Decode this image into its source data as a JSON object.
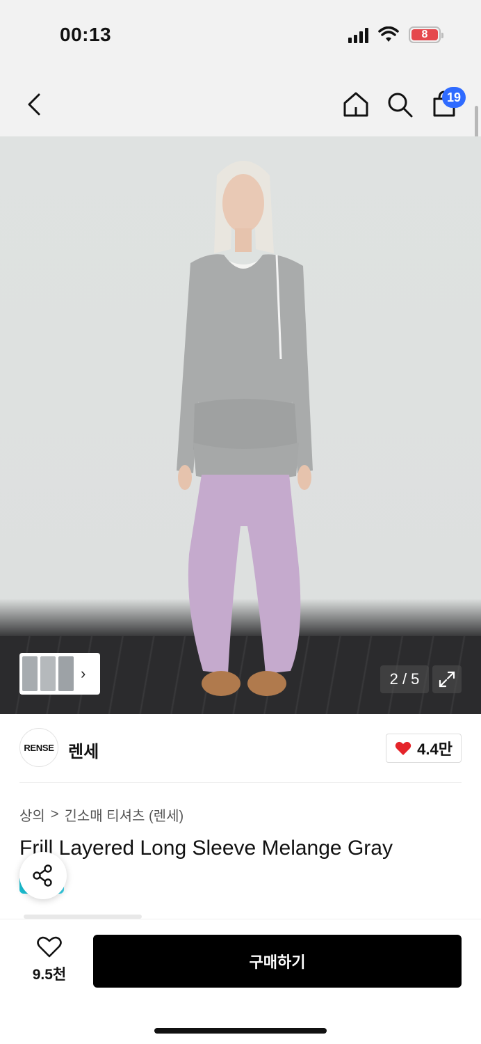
{
  "status_bar": {
    "time": "00:13",
    "battery_level": "8"
  },
  "nav": {
    "cart_count": "19"
  },
  "gallery": {
    "counter": "2 / 5"
  },
  "brand": {
    "logo_text": "RENSE",
    "name": "렌세",
    "likes": "4.4만"
  },
  "breadcrumb": {
    "category": "상의",
    "separator": ">",
    "subcategory": "긴소매 티셔츠 (렌세)"
  },
  "product": {
    "title": "Frill Layered Long Sleeve Melange Gray"
  },
  "bottom_bar": {
    "wish_count": "9.5천",
    "buy_label": "구매하기"
  },
  "colors": {
    "badge": "#2f6bff",
    "heart": "#e5242a",
    "buy_button": "#000000"
  },
  "icons": [
    "back-arrow-icon",
    "home-icon",
    "search-icon",
    "cart-icon",
    "expand-icon",
    "share-icon",
    "heart-icon",
    "chevron-right-icon"
  ]
}
